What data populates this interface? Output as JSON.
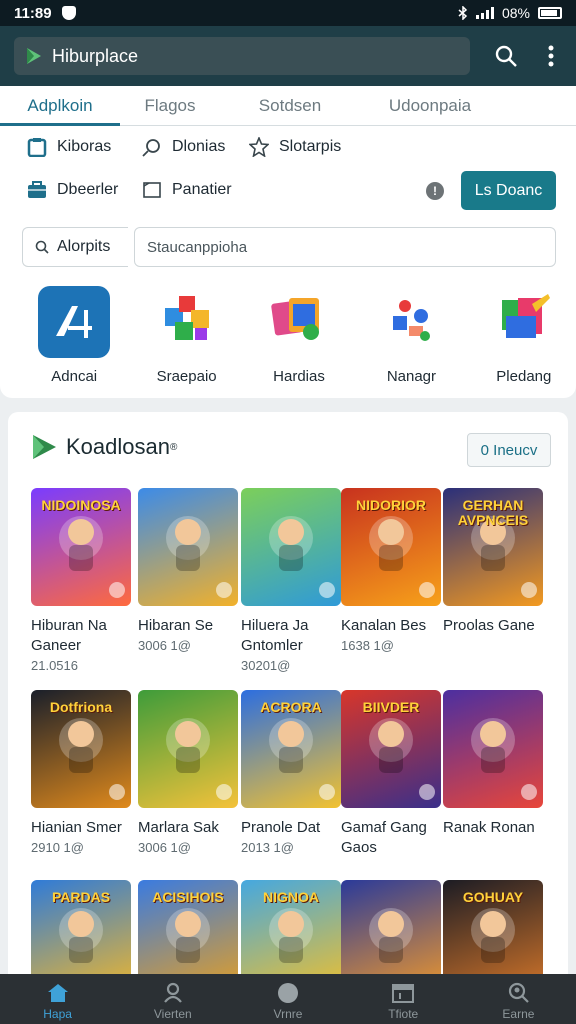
{
  "status_bar": {
    "time": "11:89",
    "battery": "08%"
  },
  "app_bar": {
    "title": "Hiburplace"
  },
  "tabs": [
    {
      "label": "Adplkoin",
      "active": true
    },
    {
      "label": "Flagos",
      "active": false
    },
    {
      "label": "Sotdsen",
      "active": false
    },
    {
      "label": "Udoonpaia",
      "active": false
    }
  ],
  "quick_links": [
    {
      "label": "Kiboras",
      "icon": "clipboard-icon"
    },
    {
      "label": "Dlonias",
      "icon": "search-icon"
    },
    {
      "label": "Slotarpis",
      "icon": "star-badge-icon"
    },
    {
      "label": "Dbeerler",
      "icon": "briefcase-icon"
    },
    {
      "label": "Panatier",
      "icon": "image-icon"
    }
  ],
  "filter_button": "Ls Doanc",
  "search": {
    "chip": "Alorpits",
    "placeholder": "Staucanppioha"
  },
  "categories": [
    {
      "label": "Adncai"
    },
    {
      "label": "Sraepaio"
    },
    {
      "label": "Hardias"
    },
    {
      "label": "Nanagr"
    },
    {
      "label": "Pledang"
    }
  ],
  "section": {
    "title": "Koadlosan",
    "link": "0 Ineucv"
  },
  "games": [
    {
      "title1": "Hiburan Na",
      "title2": "Ganeer",
      "meta": "21.0516",
      "art_text": "NIDOINOSA",
      "c1": "#7a3cff",
      "c2": "#ff6a3d"
    },
    {
      "title1": "Hibaran Se",
      "title2": "",
      "meta": "3006 1@",
      "art_text": "",
      "c1": "#3c8be8",
      "c2": "#f2b12a"
    },
    {
      "title1": "Hiluera Ja",
      "title2": "Gntomler",
      "meta": "30201@",
      "art_text": "",
      "c1": "#7ccf5a",
      "c2": "#2f9ad8"
    },
    {
      "title1": "Kanalan Bes",
      "title2": "",
      "meta": "1638 1@",
      "art_text": "NIDORIOR",
      "c1": "#c8321e",
      "c2": "#f7a11a"
    },
    {
      "title1": "Proolas Gane",
      "title2": "",
      "meta": "",
      "art_text": "GERHAN AVPNCEIS",
      "c1": "#2a2f7a",
      "c2": "#f39a20"
    },
    {
      "title1": "Hianian Smer",
      "title2": "",
      "meta": "2910 1@",
      "art_text": "Dotfriona",
      "c1": "#1a1f2a",
      "c2": "#e08a1c"
    },
    {
      "title1": "Marlara Sak",
      "title2": "",
      "meta": "3006 1@",
      "art_text": "",
      "c1": "#3e9c3a",
      "c2": "#f4c23a"
    },
    {
      "title1": "Pranole Dat",
      "title2": "",
      "meta": "2013 1@",
      "art_text": "ACRORA",
      "c1": "#2c6ee0",
      "c2": "#f2c230"
    },
    {
      "title1": "Gamaf Gang",
      "title2": "Gaos",
      "meta": "",
      "art_text": "BIIVDER",
      "c1": "#d8362a",
      "c2": "#3a2f8a"
    },
    {
      "title1": "Ranak Ronan",
      "title2": "",
      "meta": "",
      "art_text": "",
      "c1": "#4c2fa0",
      "c2": "#e8463a"
    },
    {
      "title1": "",
      "title2": "",
      "meta": "",
      "art_text": "PARDAS",
      "c1": "#2f7bd8",
      "c2": "#f2b82a"
    },
    {
      "title1": "",
      "title2": "",
      "meta": "",
      "art_text": "ACISIHOIS",
      "c1": "#3a7be0",
      "c2": "#e8a020"
    },
    {
      "title1": "",
      "title2": "",
      "meta": "",
      "art_text": "NIGNOA",
      "c1": "#45a8e0",
      "c2": "#f2c02a"
    },
    {
      "title1": "",
      "title2": "",
      "meta": "",
      "art_text": "",
      "c1": "#2a3a9a",
      "c2": "#f29a2a"
    },
    {
      "title1": "",
      "title2": "",
      "meta": "",
      "art_text": "GOHUAY",
      "c1": "#1c1c24",
      "c2": "#d8782a"
    }
  ],
  "bottom_nav": [
    {
      "label": "Hapa",
      "icon": "home-icon",
      "active": true
    },
    {
      "label": "Vierten",
      "icon": "people-icon",
      "active": false
    },
    {
      "label": "Vrnre",
      "icon": "circle-icon",
      "active": false
    },
    {
      "label": "Tfiote",
      "icon": "calendar-icon",
      "active": false
    },
    {
      "label": "Earne",
      "icon": "search-person-icon",
      "active": false
    }
  ]
}
